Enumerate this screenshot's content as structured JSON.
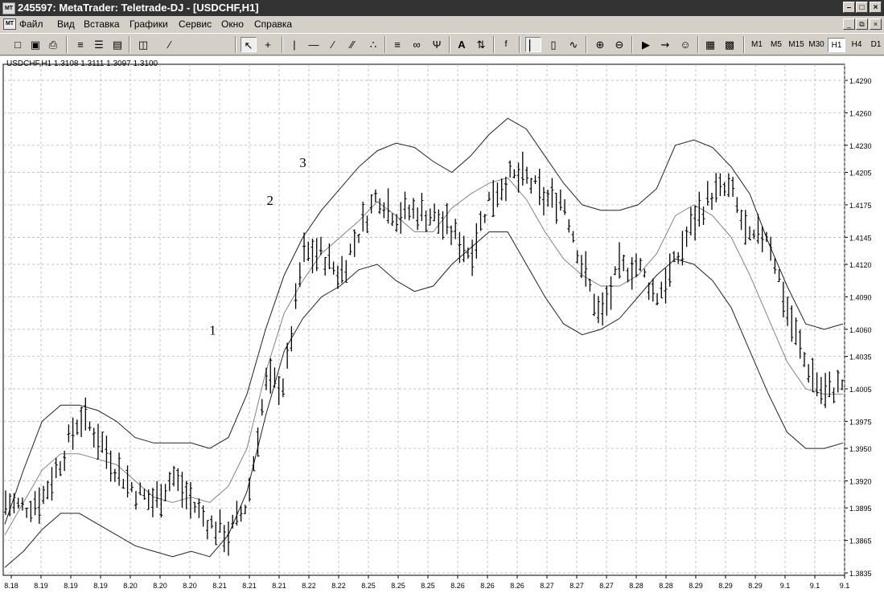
{
  "window": {
    "title": "245597: MetaTrader: Teletrade-DJ - [USDCHF,H1]",
    "app_icon": "MT"
  },
  "menu": {
    "items": [
      "Файл",
      "Вид",
      "Вставка",
      "Графики",
      "Сервис",
      "Окно",
      "Справка"
    ],
    "doc_icon": "MT"
  },
  "toolbar": {
    "icons": [
      "new-chart-icon",
      "save-icon",
      "print-icon",
      "templates-icon",
      "profiles-icon",
      "properties-icon",
      "period-icon",
      "cursor-icon",
      "crosshair-icon",
      "vertical-line-icon",
      "horizontal-line-icon",
      "trendline-icon",
      "channel-icon",
      "gann-fan-icon",
      "fibo-retracement-icon",
      "fibo-fan-icon",
      "text-icon",
      "arrows-icon",
      "functions-icon",
      "bar-chart-icon",
      "candles-icon",
      "line-chart-icon",
      "zoom-in-icon",
      "zoom-out-icon",
      "autoscroll-icon",
      "chart-shift-icon",
      "experts-icon",
      "indicators-icon",
      "templates2-icon"
    ],
    "timeframes": [
      "M1",
      "M5",
      "M15",
      "M30",
      "H1",
      "H4",
      "D1"
    ],
    "active_timeframe": "H1"
  },
  "chart_info": "USDCHF,H1   1.3108 1.3111 1.3097 1.3100",
  "chart_data": {
    "type": "ohlc-bar",
    "symbol": "USDCHF",
    "timeframe": "H1",
    "ohlc": {
      "open": 1.3108,
      "high": 1.3111,
      "low": 1.3097,
      "close": 1.31
    },
    "x_labels": [
      "8.18",
      "8.19",
      "8.19",
      "8.19",
      "8.20",
      "8.20",
      "8.20",
      "8.21",
      "8.21",
      "8.21",
      "8.22",
      "8.22",
      "8.25",
      "8.25",
      "8.25",
      "8.26",
      "8.26",
      "8.26",
      "8.27",
      "8.27",
      "8.27",
      "8.28",
      "8.28",
      "8.29",
      "8.29",
      "8.29",
      "9.1",
      "9.1",
      "9.1"
    ],
    "y_ticks": [
      "1.4290",
      "1.4260",
      "1.4230",
      "1.4205",
      "1.4175",
      "1.4145",
      "1.4120",
      "1.4090",
      "1.4060",
      "1.4035",
      "1.4005",
      "1.3975",
      "1.3950",
      "1.3920",
      "1.3895",
      "1.3865",
      "1.3835"
    ],
    "ylim": [
      1.3835,
      1.429
    ],
    "upper_band": [
      1.388,
      1.393,
      1.3975,
      1.399,
      1.399,
      1.3985,
      1.3975,
      1.396,
      1.3955,
      1.3955,
      1.3955,
      1.395,
      1.396,
      1.4,
      1.406,
      1.411,
      1.4145,
      1.417,
      1.419,
      1.421,
      1.4225,
      1.4232,
      1.4228,
      1.4215,
      1.4205,
      1.422,
      1.424,
      1.4255,
      1.4245,
      1.422,
      1.4195,
      1.4175,
      1.417,
      1.417,
      1.4175,
      1.419,
      1.423,
      1.4235,
      1.4228,
      1.421,
      1.4185,
      1.414,
      1.41,
      1.4065,
      1.406,
      1.4065
    ],
    "middle_band": [
      1.387,
      1.39,
      1.393,
      1.3945,
      1.3945,
      1.394,
      1.3935,
      1.392,
      1.3905,
      1.39,
      1.3905,
      1.39,
      1.3915,
      1.395,
      1.402,
      1.4075,
      1.4105,
      1.413,
      1.4145,
      1.416,
      1.4178,
      1.4165,
      1.415,
      1.415,
      1.4172,
      1.4185,
      1.4195,
      1.42,
      1.418,
      1.415,
      1.4125,
      1.411,
      1.41,
      1.41,
      1.411,
      1.413,
      1.4165,
      1.4175,
      1.4165,
      1.4145,
      1.411,
      1.407,
      1.403,
      1.4005,
      1.4,
      1.4
    ],
    "lower_band": [
      1.384,
      1.3855,
      1.3875,
      1.389,
      1.389,
      1.388,
      1.387,
      1.386,
      1.3855,
      1.385,
      1.3855,
      1.385,
      1.387,
      1.391,
      1.398,
      1.404,
      1.407,
      1.409,
      1.41,
      1.4115,
      1.412,
      1.4105,
      1.4095,
      1.41,
      1.412,
      1.4135,
      1.415,
      1.415,
      1.412,
      1.409,
      1.4065,
      1.4055,
      1.406,
      1.407,
      1.409,
      1.411,
      1.4125,
      1.412,
      1.4105,
      1.408,
      1.404,
      1.4,
      1.3965,
      1.395,
      1.395,
      1.3955
    ],
    "close_path": [
      1.39,
      1.3895,
      1.3905,
      1.394,
      1.398,
      1.396,
      1.393,
      1.391,
      1.39,
      1.3925,
      1.39,
      1.388,
      1.387,
      1.39,
      1.401,
      1.401,
      1.413,
      1.413,
      1.411,
      1.415,
      1.4185,
      1.4165,
      1.417,
      1.4165,
      1.415,
      1.413,
      1.418,
      1.42,
      1.42,
      1.418,
      1.418,
      1.412,
      1.407,
      1.4115,
      1.412,
      1.409,
      1.412,
      1.416,
      1.4185,
      1.419,
      1.414,
      1.415,
      1.408,
      1.403,
      1.4,
      1.401
    ],
    "annotations": [
      {
        "text": "1",
        "x_index": 14
      },
      {
        "text": "2",
        "x_index": 16
      },
      {
        "text": "3",
        "x_index": 21
      }
    ],
    "grid": true
  }
}
